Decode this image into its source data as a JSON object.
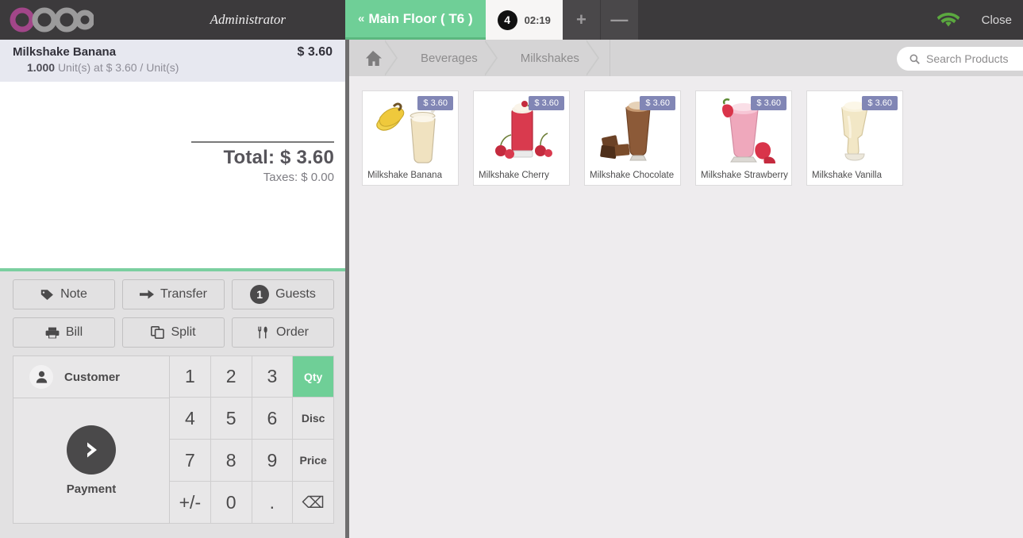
{
  "topbar": {
    "logo_text": "odoo",
    "logo_accent_color": "#A24689",
    "logo_gray_color": "#9B9A9B",
    "admin_label": "Administrator",
    "floor_tab_label": "Main Floor ( T6 )",
    "floor_tab_color": "#6FCF97",
    "order_tab": {
      "badge": "4",
      "timer": "02:19"
    },
    "add_tab_label": "+",
    "remove_tab_label": "—",
    "wifi_icon": "wifi-icon",
    "wifi_color": "#5BA83F",
    "close_label": "Close"
  },
  "order": {
    "lines": [
      {
        "name": "Milkshake Banana",
        "price": "$ 3.60",
        "detail_qty": "1.000",
        "detail_rest": "Unit(s) at $ 3.60 / Unit(s)",
        "selected": true
      }
    ],
    "total_label": "Total: $ 3.60",
    "taxes_label": "Taxes: $ 0.00"
  },
  "actions": {
    "row1": [
      {
        "label": "Note",
        "icon": "tag-icon"
      },
      {
        "label": "Transfer",
        "icon": "arrow-right-icon"
      },
      {
        "label": "Guests",
        "icon": "guest-count-badge",
        "badge": "1"
      }
    ],
    "row2": [
      {
        "label": "Bill",
        "icon": "printer-icon"
      },
      {
        "label": "Split",
        "icon": "copy-icon"
      },
      {
        "label": "Order",
        "icon": "cutlery-icon"
      }
    ]
  },
  "pad": {
    "customer_label": "Customer",
    "customer_icon": "person-icon",
    "payment_label": "Payment",
    "payment_icon": "chevron-right-icon",
    "keys": [
      {
        "label": "1",
        "type": "digit"
      },
      {
        "label": "2",
        "type": "digit"
      },
      {
        "label": "3",
        "type": "digit"
      },
      {
        "label": "Qty",
        "type": "mode",
        "active": true
      },
      {
        "label": "4",
        "type": "digit"
      },
      {
        "label": "5",
        "type": "digit"
      },
      {
        "label": "6",
        "type": "digit"
      },
      {
        "label": "Disc",
        "type": "mode",
        "active": false
      },
      {
        "label": "7",
        "type": "digit"
      },
      {
        "label": "8",
        "type": "digit"
      },
      {
        "label": "9",
        "type": "digit"
      },
      {
        "label": "Price",
        "type": "mode",
        "active": false
      },
      {
        "label": "+/-",
        "type": "digit"
      },
      {
        "label": "0",
        "type": "digit"
      },
      {
        "label": ".",
        "type": "digit"
      },
      {
        "label": "⌫",
        "type": "backspace"
      }
    ],
    "active_mode_color": "#6FCF97"
  },
  "breadcrumb": {
    "home_icon": "home-icon",
    "items": [
      "Beverages",
      "Milkshakes"
    ]
  },
  "search": {
    "icon": "search-icon",
    "placeholder": "Search Products",
    "value": ""
  },
  "products": [
    {
      "name": "Milkshake Banana",
      "price": "$ 3.60",
      "image": "banana-milkshake-image"
    },
    {
      "name": "Milkshake Cherry",
      "price": "$ 3.60",
      "image": "cherry-milkshake-image"
    },
    {
      "name": "Milkshake Chocolate",
      "price": "$ 3.60",
      "image": "chocolate-milkshake-image"
    },
    {
      "name": "Milkshake Strawberry",
      "price": "$ 3.60",
      "image": "strawberry-milkshake-image"
    },
    {
      "name": "Milkshake Vanilla",
      "price": "$ 3.60",
      "image": "vanilla-milkshake-image"
    }
  ],
  "colors": {
    "price_badge": "#8186B5",
    "topbar_bg": "#3C3A3C",
    "accent_green": "#6FCF97",
    "selected_line_bg": "#E7E8F0"
  }
}
